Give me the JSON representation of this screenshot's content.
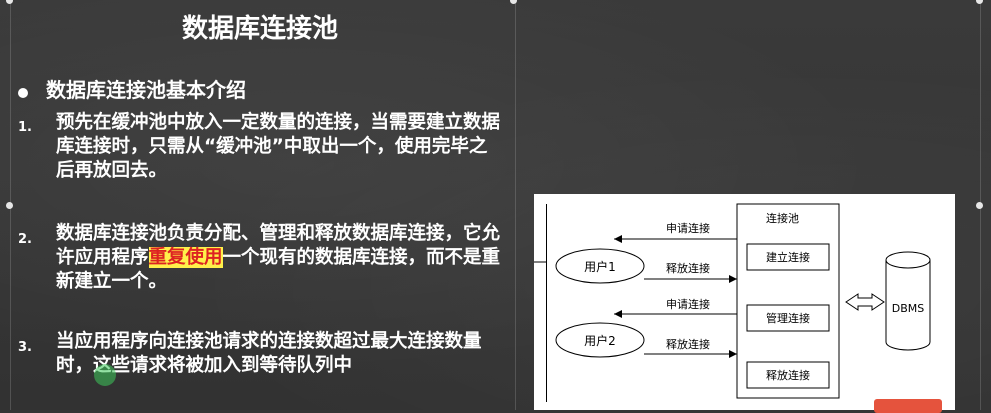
{
  "slide": {
    "title": "数据库连接池",
    "section_heading": "数据库连接池基本介绍",
    "items": [
      {
        "number": "1.",
        "text": "预先在缓冲池中放入一定数量的连接，当需要建立数据库连接时，只需从“缓冲池”中取出一个，使用完毕之后再放回去。"
      },
      {
        "number": "2.",
        "text_before": "数据库连接池负责分配、管理和释放数据库连接，它允许应用程序",
        "highlight": "重复使用",
        "text_after": "一个现有的数据库连接，而不是重新建立一个。"
      },
      {
        "number": "3.",
        "text": "当应用程序向连接池请求的连接数超过最大连接数量时，这些请求将被加入到等待队列中"
      }
    ]
  },
  "diagram": {
    "pool_title": "连接池",
    "users": [
      "用户1",
      "用户2"
    ],
    "request_label": "申请连接",
    "release_label": "释放连接",
    "pool_actions": [
      "建立连接",
      "管理连接",
      "释放连接"
    ],
    "dbms_label": "DBMS"
  },
  "colors": {
    "background": "#353535",
    "text": "#ffffff",
    "highlight_bg": "#fff04a",
    "highlight_text": "#dd2222"
  }
}
